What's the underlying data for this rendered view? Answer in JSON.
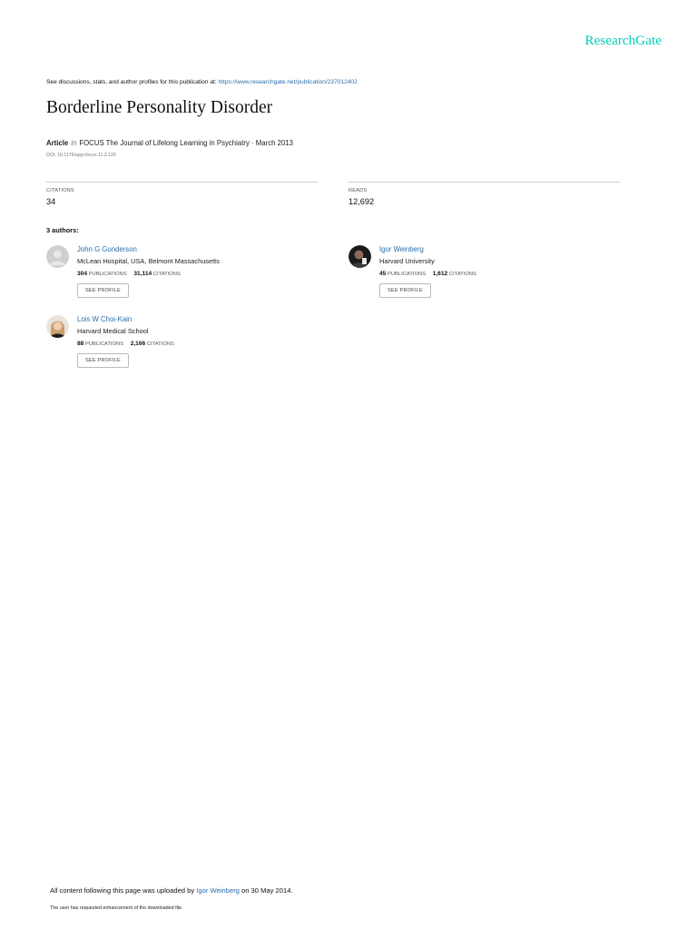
{
  "logo": "ResearchGate",
  "discussion": {
    "prefix": "See discussions, stats, and author profiles for this publication at:",
    "url": "https://www.researchgate.net/publication/237012402"
  },
  "title": "Borderline Personality Disorder",
  "meta": {
    "type": "Article",
    "in": "in",
    "journal": "FOCUS The Journal of Lifelong Learning in Psychiatry · March 2013",
    "doi": "DOI: 10.1176/appi.focus.11.2.129"
  },
  "stats": {
    "citations_label": "Citations",
    "citations_value": "34",
    "reads_label": "Reads",
    "reads_value": "12,692"
  },
  "authors_heading": "3 authors:",
  "authors": [
    {
      "name": "John G Gunderson",
      "affiliation": "McLean Hospital, USA, Belmont Massachusetts",
      "publications": "304",
      "citations": "31,114",
      "publications_label": "PUBLICATIONS",
      "citations_label": "CITATIONS",
      "button": "See profile"
    },
    {
      "name": "Igor Weinberg",
      "affiliation": "Harvard University",
      "publications": "45",
      "citations": "1,612",
      "publications_label": "PUBLICATIONS",
      "citations_label": "CITATIONS",
      "button": "See profile"
    },
    {
      "name": "Lois W Choi-Kain",
      "affiliation": "Harvard Medical School",
      "publications": "88",
      "citations": "2,166",
      "publications_label": "PUBLICATIONS",
      "citations_label": "CITATIONS",
      "button": "See profile"
    }
  ],
  "footer": {
    "upload_prefix": "All content following this page was uploaded by",
    "uploader": "Igor Weinberg",
    "upload_suffix": "on 30 May 2014.",
    "note": "The user has requested enhancement of the downloaded file."
  },
  "colors": {
    "brand": "#00ccbb",
    "link": "#2b6ea8"
  }
}
